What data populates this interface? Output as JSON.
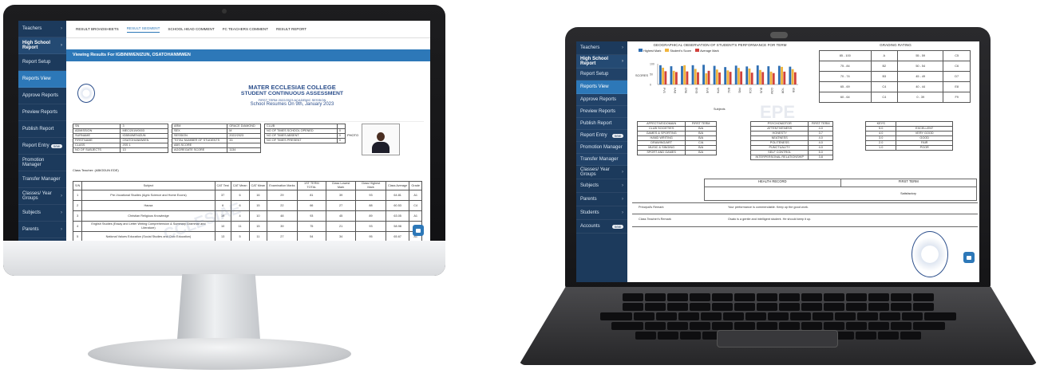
{
  "desktop": {
    "tabs": [
      "RESULT BROADSHEETS",
      "RESULT SEGMENT",
      "SCHOOL HEAD COMMENT",
      "FC TEACHERS COMMENT",
      "RESULT REPORT"
    ],
    "active_tab": 1,
    "banner": "Viewing Results For IGBINIWENIZUN, OSATOHANMWEN",
    "school": {
      "name": "MATER ECCLESIAE COLLEGE",
      "subtitle": "STUDENT CONTINUOUS ASSESSMENT",
      "term_line": "FIRST TERM 2022/2023 ACADEMIC SESSION",
      "resumption": "School Resumes On 9th, January 2023"
    },
    "info_left": [
      [
        "SN",
        "3"
      ],
      [
        "ADMISSION",
        "MEC/2019/0003"
      ],
      [
        "SURNAME",
        "IGBINIWENIZUN"
      ],
      [
        "FIRSTNAME",
        "OSATOHANMWEN"
      ],
      [
        "CLASS",
        "JSS 1"
      ],
      [
        "NO OF SUBJECTS",
        "13"
      ]
    ],
    "info_mid": [
      [
        "ARM",
        "GRACE DIAMOND"
      ],
      [
        "SEX",
        "M"
      ],
      [
        "SESSION",
        "2022/2023"
      ],
      [
        "TOTAL NUMBER OF STUDENTS",
        "33"
      ],
      [
        "ABS SCORE",
        ""
      ],
      [
        "AGGREGATE SCORE",
        "1134"
      ]
    ],
    "info_right": [
      [
        "CLUB",
        ""
      ],
      [
        "NO OF TIMES SCHOOL OPENED",
        "0"
      ],
      [
        "NO OF TIMES ABSENT",
        "0"
      ],
      [
        "NO OF TIMES PRESENT",
        "0"
      ]
    ],
    "photo_label": "PHOTO",
    "class_teacher": "Class Teacher: (ABIODUN EDE)",
    "score_headers": [
      "S/N",
      "Subject",
      "CAT Test",
      "CAT Mean",
      "CAT Mean",
      "Examination Marks",
      "1ST TERM TOTAL",
      "Class Lowest Mark",
      "Class Highest Mark",
      "Class Average",
      "Grade"
    ],
    "score_rows": [
      [
        "1",
        "Pre-Vocational Studies (Agric Science and Home Econs)",
        "37",
        "6",
        "16",
        "29",
        "81",
        "39",
        "93",
        "64.81",
        "A1"
      ],
      [
        "2",
        "Hausa",
        "6",
        "6",
        "15",
        "22",
        "66",
        "27",
        "88",
        "60.53",
        "C4"
      ],
      [
        "3",
        "Christian Religious Knowledge",
        "19",
        "4",
        "10",
        "48",
        "93",
        "45",
        "89",
        "63.05",
        "A1"
      ],
      [
        "4",
        "English Studies (Essay and Letter Writing Comprehension & Summary Grammar and Literature)",
        "10",
        "11",
        "15",
        "39",
        "75",
        "21",
        "93",
        "58.98",
        "A1"
      ],
      [
        "5",
        "National Values Education (Social Studies and Civic Education)",
        "13",
        "5",
        "11",
        "27",
        "54",
        "34",
        "95",
        "65.67",
        "A1"
      ]
    ],
    "sidebar": [
      {
        "label": "Teachers",
        "badge": ""
      },
      {
        "label": "High School Report",
        "badge": ""
      },
      {
        "label": "Report Setup",
        "badge": ""
      },
      {
        "label": "Reports View",
        "badge": ""
      },
      {
        "label": "Approve Reports",
        "badge": ""
      },
      {
        "label": "Preview Reports",
        "badge": ""
      },
      {
        "label": "Publish Report",
        "badge": ""
      },
      {
        "label": "Report Entry",
        "badge": "new"
      },
      {
        "label": "Promotion Manager",
        "badge": ""
      },
      {
        "label": "Transfer Manager",
        "badge": ""
      },
      {
        "label": "Classes/ Year Groups",
        "badge": ""
      },
      {
        "label": "Subjects",
        "badge": ""
      },
      {
        "label": "Parents",
        "badge": ""
      },
      {
        "label": "Students",
        "badge": ""
      },
      {
        "label": "Accounts",
        "badge": "new"
      }
    ]
  },
  "laptop": {
    "chart_data": {
      "type": "bar",
      "title": "GEOGRAPHICAL OBSERVATION OF STUDENT'S PERFORMANCE FOR TERM",
      "series": [
        {
          "name": "Highest Mark",
          "color": "#2f6fb3",
          "values": [
            93,
            88,
            89,
            93,
            95,
            90,
            84,
            91,
            87,
            92,
            88,
            90,
            86
          ]
        },
        {
          "name": "Student's Score",
          "color": "#f0b43c",
          "values": [
            81,
            66,
            93,
            75,
            54,
            72,
            68,
            80,
            77,
            70,
            62,
            85,
            74
          ]
        },
        {
          "name": "Average Mark",
          "color": "#d0413b",
          "values": [
            64,
            60,
            63,
            59,
            66,
            58,
            61,
            63,
            57,
            60,
            55,
            62,
            59
          ]
        }
      ],
      "ylim": [
        0,
        100
      ],
      "ylabel": "SCORES",
      "categories": [
        "PVS",
        "HAU",
        "CRK",
        "ENG",
        "NVE",
        "MTH",
        "BSC",
        "FRE",
        "CCA",
        "BUS",
        "COM",
        "YOR",
        "IGB"
      ],
      "xlabel": "Subjects"
    },
    "grading_title": "GRADING RATING",
    "grading": [
      [
        "85 - 100",
        "A",
        "55 - 59",
        "C5"
      ],
      [
        "75 - 84",
        "B2",
        "50 - 54",
        "C6"
      ],
      [
        "70 - 74",
        "B3",
        "45 - 49",
        "D7"
      ],
      [
        "65 - 69",
        "C4",
        "40 - 44",
        "E8"
      ],
      [
        "60 - 64",
        "C4",
        "0 - 39",
        "F9"
      ]
    ],
    "affective": {
      "headers": [
        "AFFECTIVE/DOMAIN",
        "FIRST TERM"
      ],
      "rows": [
        [
          "CLUB SOCIETIES",
          "B/A"
        ],
        [
          "GAMES & SPORTING",
          "B/A"
        ],
        [
          "HAND WRITING",
          "B/A"
        ],
        [
          "DRAWING/ART",
          "C/A"
        ],
        [
          "MUSIC & SINGING",
          "B/A"
        ],
        [
          "SPORT AND GAMES",
          "B/A"
        ]
      ]
    },
    "psychomotor": {
      "headers": [
        "PSYCHOMOTOR",
        "FIRST TERM"
      ],
      "rows": [
        [
          "ATTENTIVENESS",
          "4.0"
        ],
        [
          "HONESTY",
          "3.7"
        ],
        [
          "NEATNESS",
          "4.0"
        ],
        [
          "POLITENESS",
          "4.0"
        ],
        [
          "PUNCTUALITY",
          "4.0"
        ],
        [
          "SELF CONTROL",
          "5.0"
        ],
        [
          "INTERPERSONAL RELATIONSHIP",
          "3.8"
        ]
      ]
    },
    "key": {
      "headers": [
        "KEYS",
        ""
      ],
      "rows": [
        [
          "5.0",
          "EXCELLENT"
        ],
        [
          "4.0",
          "VERY GOOD"
        ],
        [
          "3.0",
          "GOOD"
        ],
        [
          "2.0",
          "FAIR"
        ],
        [
          "1.0",
          "POOR"
        ]
      ]
    },
    "health_header": "HEALTH RECORD",
    "health_term": "FIRST TERM",
    "health_value": "Satisfactory",
    "principal_label": "Principal's Remark",
    "principal_remark": "Your performance is commendable. Keep up the good work.",
    "teacher_label": "Class Teacher's Remark",
    "teacher_remark": "Osato is a gentle and intelligent student. He should keep it up.",
    "watermark": "EPE",
    "sidebar": [
      {
        "label": "Teachers",
        "badge": ""
      },
      {
        "label": "High School Report",
        "badge": ""
      },
      {
        "label": "Report Setup",
        "badge": ""
      },
      {
        "label": "Reports View",
        "badge": ""
      },
      {
        "label": "Approve Reports",
        "badge": ""
      },
      {
        "label": "Preview Reports",
        "badge": ""
      },
      {
        "label": "Publish Report",
        "badge": ""
      },
      {
        "label": "Report Entry",
        "badge": "new"
      },
      {
        "label": "Promotion Manager",
        "badge": ""
      },
      {
        "label": "Transfer Manager",
        "badge": ""
      },
      {
        "label": "Classes/ Year Groups",
        "badge": ""
      },
      {
        "label": "Subjects",
        "badge": ""
      },
      {
        "label": "Parents",
        "badge": ""
      },
      {
        "label": "Students",
        "badge": ""
      },
      {
        "label": "Accounts",
        "badge": "new"
      }
    ]
  }
}
